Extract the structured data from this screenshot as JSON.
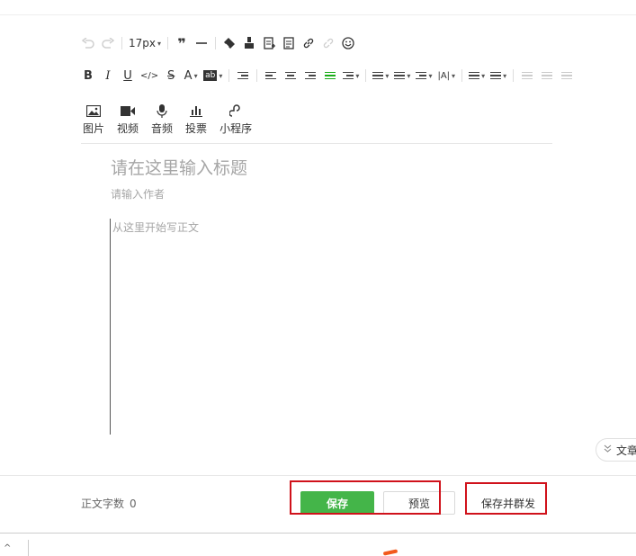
{
  "toolbar": {
    "font_size": "17px",
    "undo": "undo",
    "redo": "redo",
    "quote": "blockquote",
    "hr": "horizontal-rule",
    "clear_format": "clear-format",
    "format_brush": "format-brush",
    "template": "insert-template",
    "paste_text": "paste-plain-text",
    "link": "insert-link",
    "unlink": "remove-link",
    "emoji": "emoji",
    "bold": "B",
    "italic": "I",
    "underline": "U",
    "code": "</>",
    "strike": "S",
    "font_color": "A",
    "bg_color": "ab",
    "line_height_label": "|A|"
  },
  "insert": [
    {
      "label": "图片",
      "icon": "image-icon"
    },
    {
      "label": "视频",
      "icon": "video-icon"
    },
    {
      "label": "音频",
      "icon": "microphone-icon"
    },
    {
      "label": "投票",
      "icon": "vote-chart-icon"
    },
    {
      "label": "小程序",
      "icon": "mini-program-icon"
    }
  ],
  "editor": {
    "title_placeholder": "请在这里输入标题",
    "author_placeholder": "请输入作者",
    "body_placeholder": "从这里开始写正文"
  },
  "side_tab": {
    "label": "文章"
  },
  "footer": {
    "word_count_label": "正文字数",
    "word_count_value": "0",
    "save": "保存",
    "preview": "预览",
    "save_and_mass_send": "保存并群发"
  },
  "bottom": {
    "arrow": "^"
  },
  "colors": {
    "accent_green": "#44b549",
    "highlight_red": "#d0121b",
    "placeholder_gray": "#a6a6a6"
  }
}
